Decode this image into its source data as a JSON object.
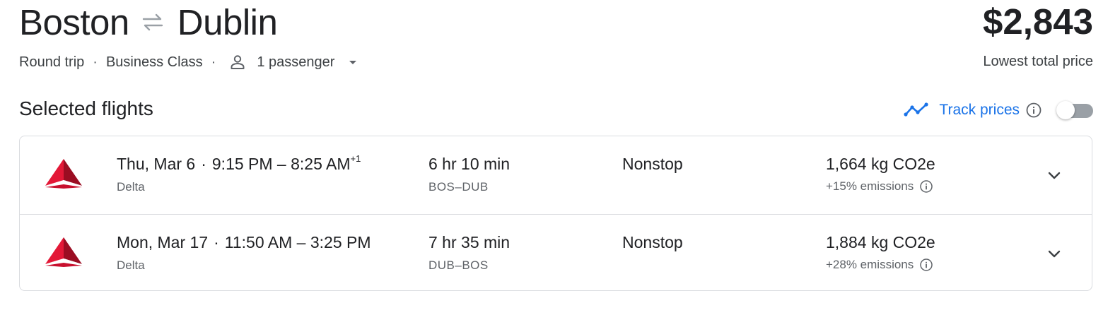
{
  "header": {
    "origin": "Boston",
    "destination": "Dublin",
    "price": "$2,843",
    "price_note": "Lowest total price"
  },
  "meta": {
    "trip_type": "Round trip",
    "cabin": "Business Class",
    "passengers": "1 passenger"
  },
  "section": {
    "title": "Selected flights",
    "track_label": "Track prices",
    "track_enabled": false
  },
  "flights": [
    {
      "date": "Thu, Mar 6",
      "depart": "9:15 PM",
      "arrive": "8:25 AM",
      "day_offset": "+1",
      "airline": "Delta",
      "duration": "6 hr 10 min",
      "airports": "BOS–DUB",
      "stops": "Nonstop",
      "co2": "1,664 kg CO2e",
      "emissions": "+15% emissions"
    },
    {
      "date": "Mon, Mar 17",
      "depart": "11:50 AM",
      "arrive": "3:25 PM",
      "day_offset": "",
      "airline": "Delta",
      "duration": "7 hr 35 min",
      "airports": "DUB–BOS",
      "stops": "Nonstop",
      "co2": "1,884 kg CO2e",
      "emissions": "+28% emissions"
    }
  ],
  "colors": {
    "accent": "#1a73e8",
    "delta_red": "#c8102e",
    "text_primary": "#202124",
    "text_secondary": "#5f6368",
    "border": "#dadce0"
  }
}
